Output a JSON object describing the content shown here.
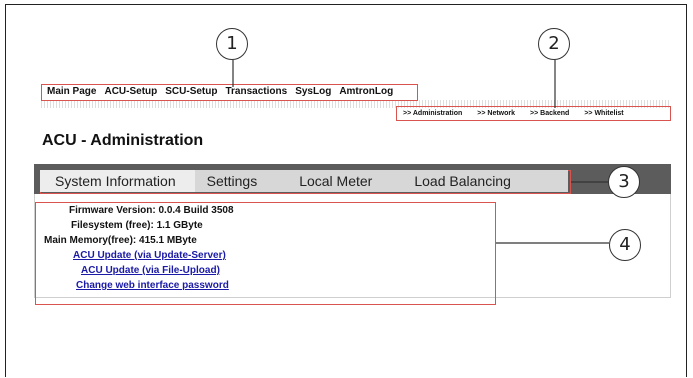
{
  "nav": {
    "items": [
      {
        "label": "Main Page"
      },
      {
        "label": "ACU-Setup"
      },
      {
        "label": "SCU-Setup"
      },
      {
        "label": "Transactions"
      },
      {
        "label": "SysLog"
      },
      {
        "label": "AmtronLog"
      }
    ]
  },
  "subnav": {
    "items": [
      {
        "label": ">> Administration"
      },
      {
        "label": ">> Network"
      },
      {
        "label": ">> Backend"
      },
      {
        "label": ">> Whitelist"
      }
    ]
  },
  "page": {
    "title": "ACU - Administration"
  },
  "tabs": [
    {
      "label": "System Information"
    },
    {
      "label": "Settings"
    },
    {
      "label": "Local Meter"
    },
    {
      "label": "Load Balancing"
    }
  ],
  "info": {
    "firmware": "Firmware Version: 0.0.4 Build 3508",
    "filesystem": "Filesystem (free): 1.1 GByte",
    "memory": "Main Memory(free): 415.1 MByte"
  },
  "links": [
    {
      "label": "ACU Update (via Update-Server)"
    },
    {
      "label": "ACU Update (via File-Upload)"
    },
    {
      "label": "Change web interface password"
    }
  ],
  "callouts": [
    "1",
    "2",
    "3",
    "4"
  ],
  "colors": {
    "highlight_box": "#d9534f",
    "link": "#1a1aa6",
    "tabbar": "#5c5c5c"
  }
}
